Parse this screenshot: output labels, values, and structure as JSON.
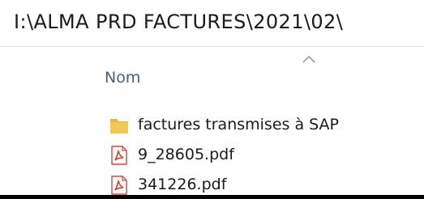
{
  "address_bar": {
    "path": "I:\\ALMA PRD FACTURES\\2021\\02\\"
  },
  "file_list": {
    "sort_indicator": "chevron-up-icon",
    "column_name": "Nom",
    "items": [
      {
        "name": "factures transmises à SAP",
        "icon": "folder-icon"
      },
      {
        "name": "9_28605.pdf",
        "icon": "pdf-file-icon"
      },
      {
        "name": "341226.pdf",
        "icon": "pdf-file-icon"
      }
    ]
  },
  "colors": {
    "header_text": "#4c607a",
    "folder": "#f3c951",
    "pdf_accent": "#e2312b"
  }
}
